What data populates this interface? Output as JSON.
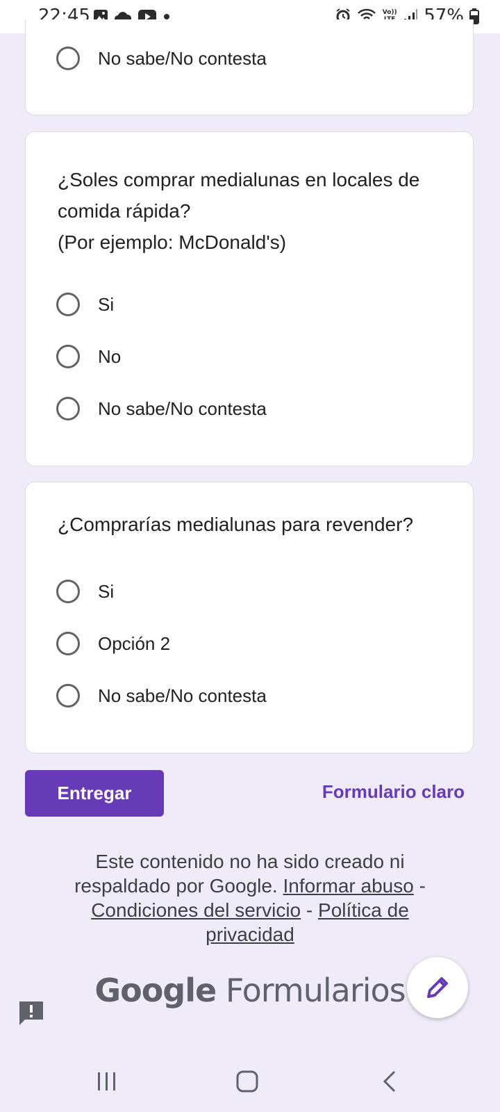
{
  "status_bar": {
    "time": "22:45",
    "battery": "57%",
    "icons": [
      "gallery-icon",
      "cloud-icon",
      "youtube-icon",
      "dot-icon",
      "alarm-icon",
      "wifi-icon",
      "volte-icon",
      "signal-icon",
      "battery-icon"
    ],
    "volte_label": "Vo)) LTE"
  },
  "cards": [
    {
      "title": "",
      "options": [
        "No sabe/No contesta"
      ]
    },
    {
      "title": "¿Soles comprar medialunas en locales de comida rápida?\n(Por ejemplo: McDonald's)",
      "options": [
        "Si",
        "No",
        "No sabe/No contesta"
      ]
    },
    {
      "title": "¿Comprarías medialunas para revender?",
      "options": [
        "Si",
        "Opción 2",
        "No sabe/No contesta"
      ]
    }
  ],
  "actions": {
    "submit_label": "Entregar",
    "clear_label": "Formulario claro"
  },
  "footer": {
    "text": "Este contenido no ha sido creado ni respaldado por Google.",
    "link_abuse": "Informar abuso",
    "sep": "-",
    "link_terms": "Condiciones del servicio",
    "link_privacy": "Política de privacidad"
  },
  "brand": {
    "google": "Google",
    "product": "Formularios"
  },
  "colors": {
    "accent": "#673ab7",
    "background": "#f0ebf8"
  },
  "nav_icons": [
    "recent-apps-icon",
    "home-icon",
    "back-icon"
  ]
}
